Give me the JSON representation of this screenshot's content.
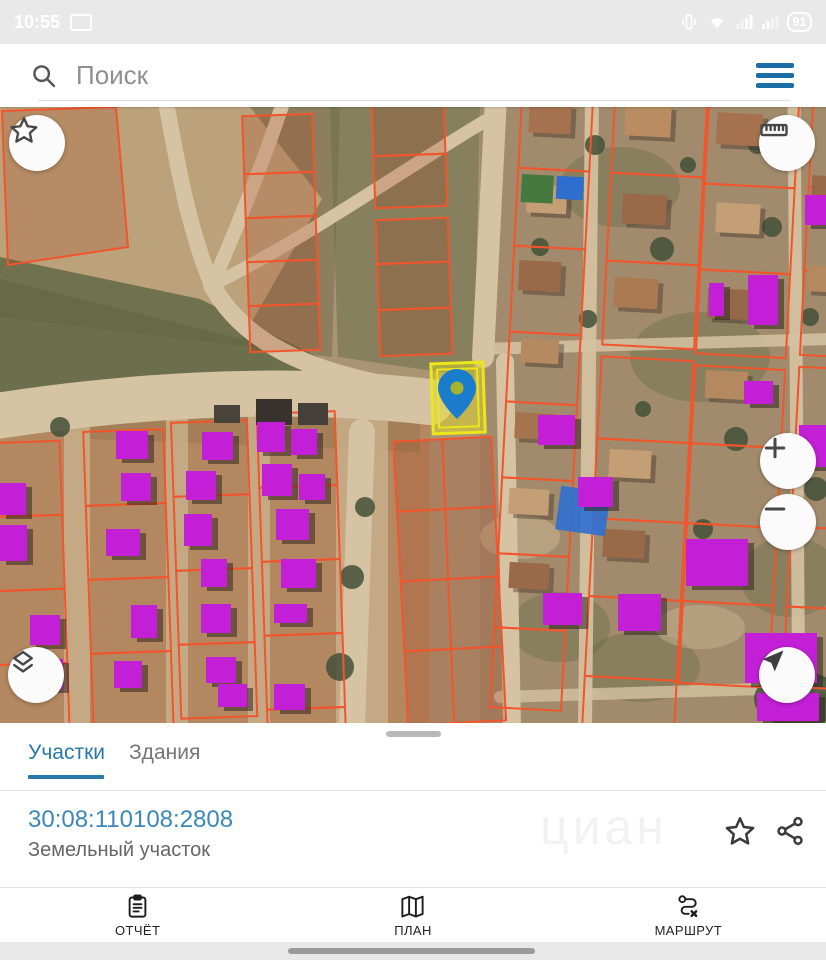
{
  "status_bar": {
    "time": "10:55",
    "battery": "91"
  },
  "search": {
    "placeholder": "Поиск"
  },
  "tabs": [
    {
      "label": "Участки",
      "active": true
    },
    {
      "label": "Здания",
      "active": false
    }
  ],
  "parcel": {
    "id": "30:08:110108:2808",
    "type": "Земельный участок"
  },
  "watermark": "циан",
  "nav": [
    {
      "label": "ОТЧЁТ",
      "icon": "report-clipboard"
    },
    {
      "label": "ПЛАН",
      "icon": "folded-map"
    },
    {
      "label": "МАРШРУТ",
      "icon": "route"
    }
  ],
  "icons": {
    "search": "magnifier",
    "menu": "hamburger-3-lines-blue",
    "map_controls": [
      "favorites-star",
      "ruler",
      "zoom-plus",
      "zoom-minus",
      "layers",
      "navigate-arrow"
    ],
    "row_actions": [
      "favorite-star-outline",
      "share-nodes"
    ]
  },
  "colors": {
    "accent_blue": "#2779ab",
    "link_blue": "#3c87ba",
    "menu_blue": "#1a6da6",
    "parcel_outline_orange": "#f2552c",
    "building_highlight_purple": "#c21fd6",
    "selected_parcel_yellow": "#ece61b",
    "pin_blue": "#1a7ccc"
  }
}
